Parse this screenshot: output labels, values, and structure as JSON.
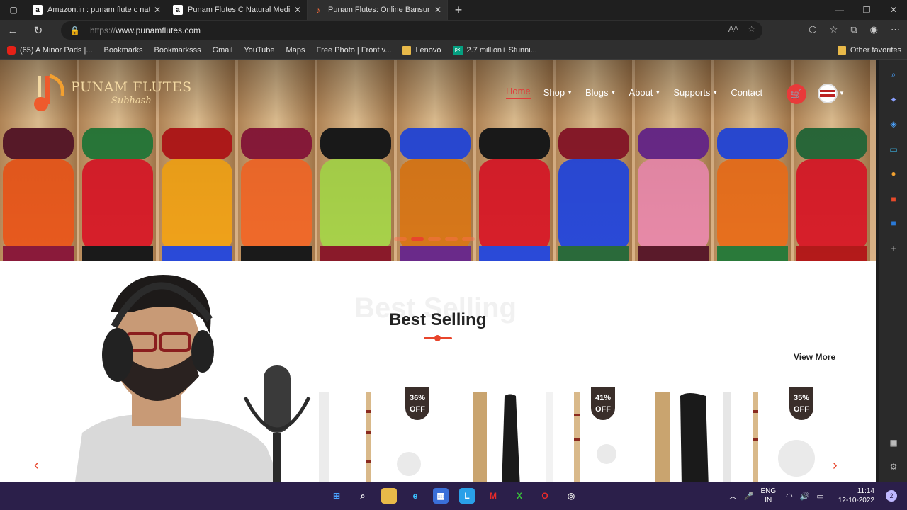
{
  "browser": {
    "tabs": [
      {
        "title": "Amazon.in : punam flute c natur",
        "favicon": "amazon-icon",
        "active": false
      },
      {
        "title": "Punam Flutes C Natural Medium",
        "favicon": "amazon-icon",
        "active": false
      },
      {
        "title": "Punam Flutes: Online Bansuri Sh",
        "favicon": "punam-flutes-icon",
        "active": true
      }
    ],
    "url_scheme": "https://",
    "url_host": "www.punamflutes.com",
    "bookmarks": [
      {
        "label": "(65) A Minor Pads |...",
        "icon": "youtube-icon"
      },
      {
        "label": "Bookmarks",
        "icon": "page-icon"
      },
      {
        "label": "Bookmarksss",
        "icon": "page-icon"
      },
      {
        "label": "Gmail",
        "icon": "page-icon"
      },
      {
        "label": "YouTube",
        "icon": "page-icon"
      },
      {
        "label": "Maps",
        "icon": "page-icon"
      },
      {
        "label": "Free Photo | Front v...",
        "icon": "page-icon"
      },
      {
        "label": "Lenovo",
        "icon": "folder-icon"
      },
      {
        "label": "2.7 million+ Stunni...",
        "icon": "pexels-icon"
      }
    ],
    "other_favorites": "Other favorites"
  },
  "site": {
    "logo_title": "PUNAM FLUTES",
    "logo_subtitle": "Subhash",
    "nav": [
      {
        "label": "Home",
        "active": true,
        "dropdown": false
      },
      {
        "label": "Shop",
        "active": false,
        "dropdown": true
      },
      {
        "label": "Blogs",
        "active": false,
        "dropdown": true
      },
      {
        "label": "About",
        "active": false,
        "dropdown": true
      },
      {
        "label": "Supports",
        "active": false,
        "dropdown": true
      },
      {
        "label": "Contact",
        "active": false,
        "dropdown": false
      }
    ],
    "slider_active_index": 1,
    "slider_count": 5,
    "section_title": "Best Selling",
    "view_more": "View More",
    "products": [
      {
        "discount": "36%",
        "suffix": "OFF"
      },
      {
        "discount": "41%",
        "suffix": "OFF"
      },
      {
        "discount": "35%",
        "suffix": "OFF"
      }
    ],
    "colors": {
      "accent": "#e8452c",
      "badge": "#3a2e2a"
    }
  },
  "taskbar": {
    "lang_top": "ENG",
    "lang_bottom": "IN",
    "time": "11:14",
    "date": "12-10-2022",
    "notifications": "2"
  }
}
